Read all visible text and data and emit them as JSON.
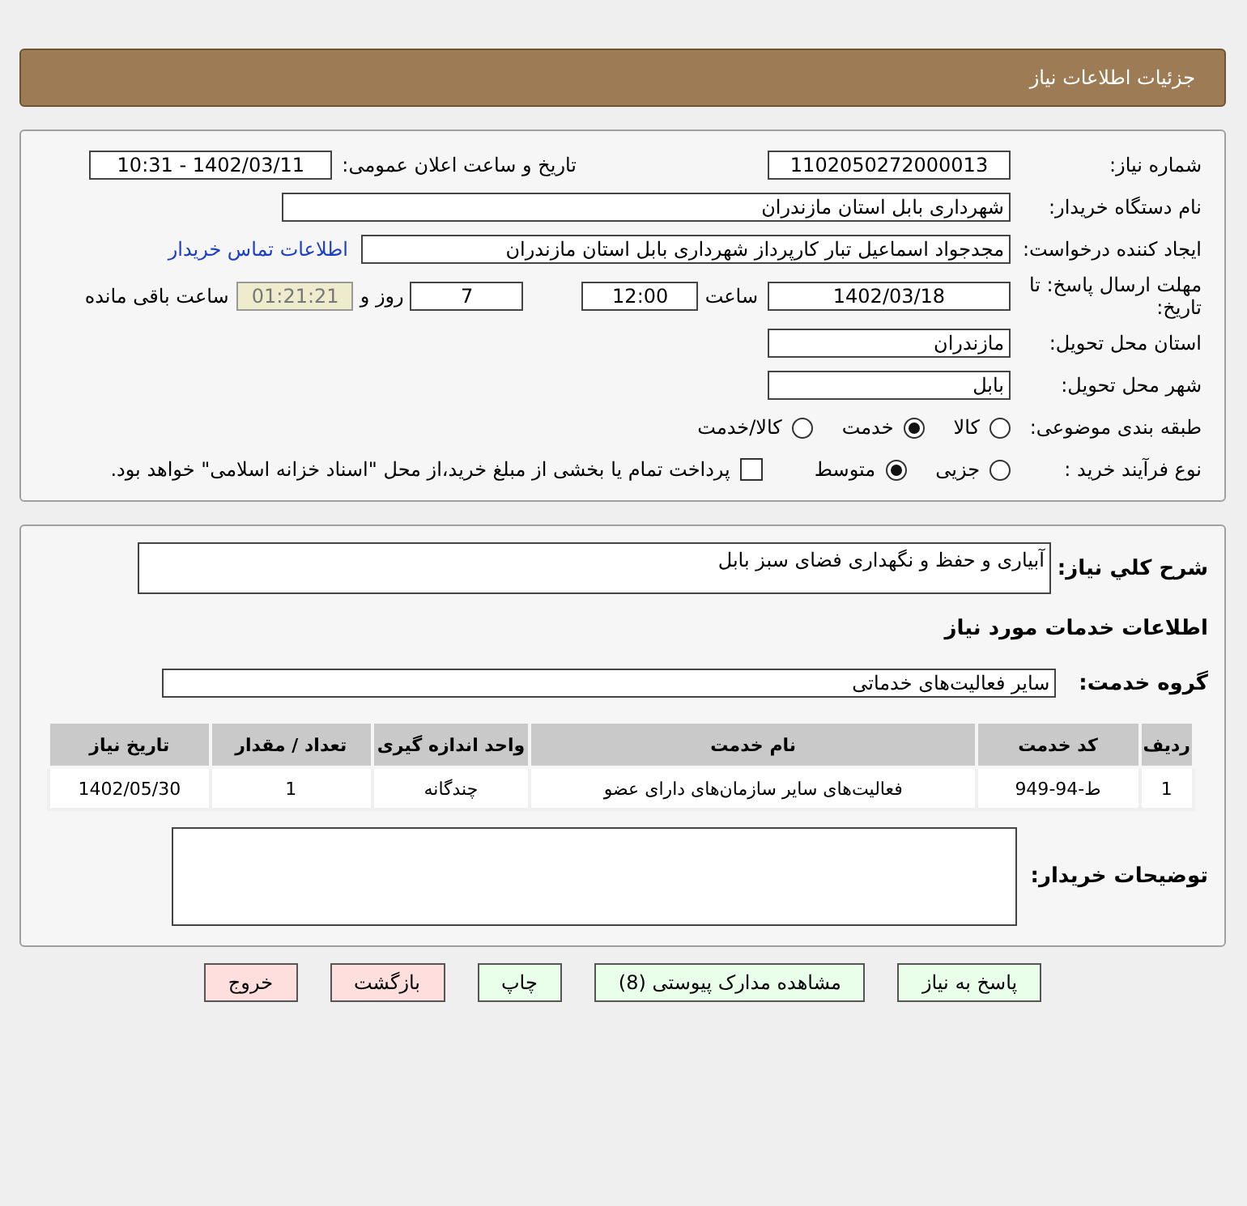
{
  "header": {
    "title": "جزئیات اطلاعات نیاز"
  },
  "need_number": {
    "label": "شماره نیاز:",
    "value": "1102050272000013"
  },
  "announce": {
    "label": "تاریخ و ساعت اعلان عمومی:",
    "value": "1402/03/11 - 10:31"
  },
  "buyer": {
    "label": "نام دستگاه خریدار:",
    "value": "شهرداری بابل استان مازندران"
  },
  "creator": {
    "label": "ایجاد کننده درخواست:",
    "value": "مجدجواد اسماعیل تبار کارپرداز شهرداری بابل استان مازندران",
    "link": "اطلاعات تماس خریدار"
  },
  "deadline": {
    "label": "مهلت ارسال پاسخ: تا تاریخ:",
    "date": "1402/03/18",
    "time_label": "ساعت",
    "time": "12:00",
    "days": "7",
    "days_label": "روز و",
    "remaining": "01:21:21",
    "remaining_label": "ساعت باقی مانده"
  },
  "province": {
    "label": "استان محل تحویل:",
    "value": "مازندران"
  },
  "city": {
    "label": "شهر محل تحویل:",
    "value": "بابل"
  },
  "category": {
    "label": "طبقه بندی موضوعی:",
    "options": [
      {
        "label": "کالا",
        "selected": false
      },
      {
        "label": "خدمت",
        "selected": true
      },
      {
        "label": "کالا/خدمت",
        "selected": false
      }
    ]
  },
  "process": {
    "label": "نوع فرآیند خرید :",
    "options": [
      {
        "label": "جزیی",
        "selected": false
      },
      {
        "label": "متوسط",
        "selected": true
      }
    ],
    "payment": {
      "checked": false,
      "label": "پرداخت تمام یا بخشی از مبلغ خرید،از محل \"اسناد خزانه اسلامی\" خواهد بود."
    }
  },
  "description": {
    "label": "شرح کلي نياز:",
    "value": "آبیاری و حفظ و نگهداری فضای سبز بابل"
  },
  "services_heading": "اطلاعات خدمات مورد نیاز",
  "service_group": {
    "label": "گروه خدمت:",
    "value": "سایر فعالیت‌های خدماتی"
  },
  "table": {
    "columns": [
      "ردیف",
      "کد خدمت",
      "نام خدمت",
      "واحد اندازه گیری",
      "تعداد / مقدار",
      "تاریخ نیاز"
    ],
    "rows": [
      [
        "1",
        "ط-94-949",
        "فعالیت‌های سایر سازمان‌های دارای عضو",
        "چندگانه",
        "1",
        "1402/05/30"
      ]
    ]
  },
  "buyer_notes": {
    "label": "توضیحات خریدار:"
  },
  "buttons": [
    {
      "label": "پاسخ به نیاز",
      "kind": "normal"
    },
    {
      "label": "مشاهده مدارک پیوستی (8)",
      "kind": "normal"
    },
    {
      "label": "چاپ",
      "kind": "normal"
    },
    {
      "label": "بازگشت",
      "kind": "danger"
    },
    {
      "label": "خروج",
      "kind": "danger"
    }
  ]
}
